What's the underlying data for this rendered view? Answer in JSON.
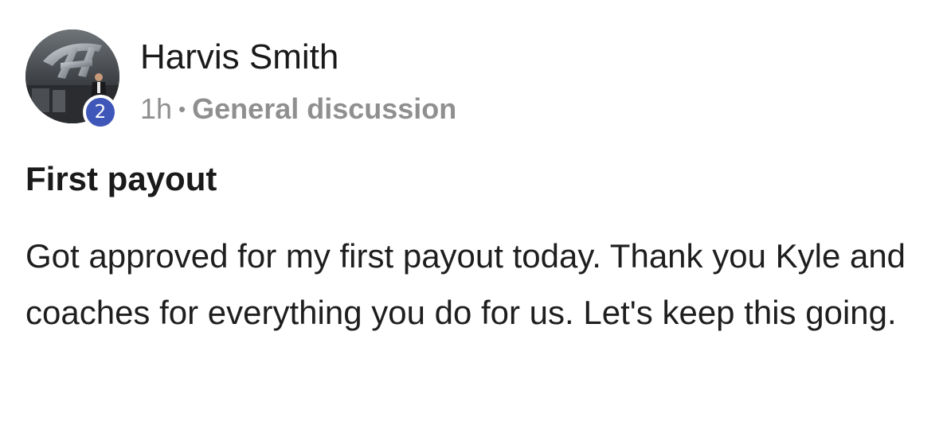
{
  "post": {
    "author": {
      "name": "Harvis Smith",
      "level": "2",
      "avatar_icon": "user-avatar-photo"
    },
    "meta": {
      "time": "1h",
      "separator": "•",
      "category": "General discussion"
    },
    "title": "First payout",
    "body": "Got approved for my first payout today. Thank you Kyle and coaches for everything you do for us. Let's keep this going."
  },
  "colors": {
    "badge": "#3f57b8",
    "meta_text": "#8f8f8f",
    "text": "#1a1a1a"
  }
}
